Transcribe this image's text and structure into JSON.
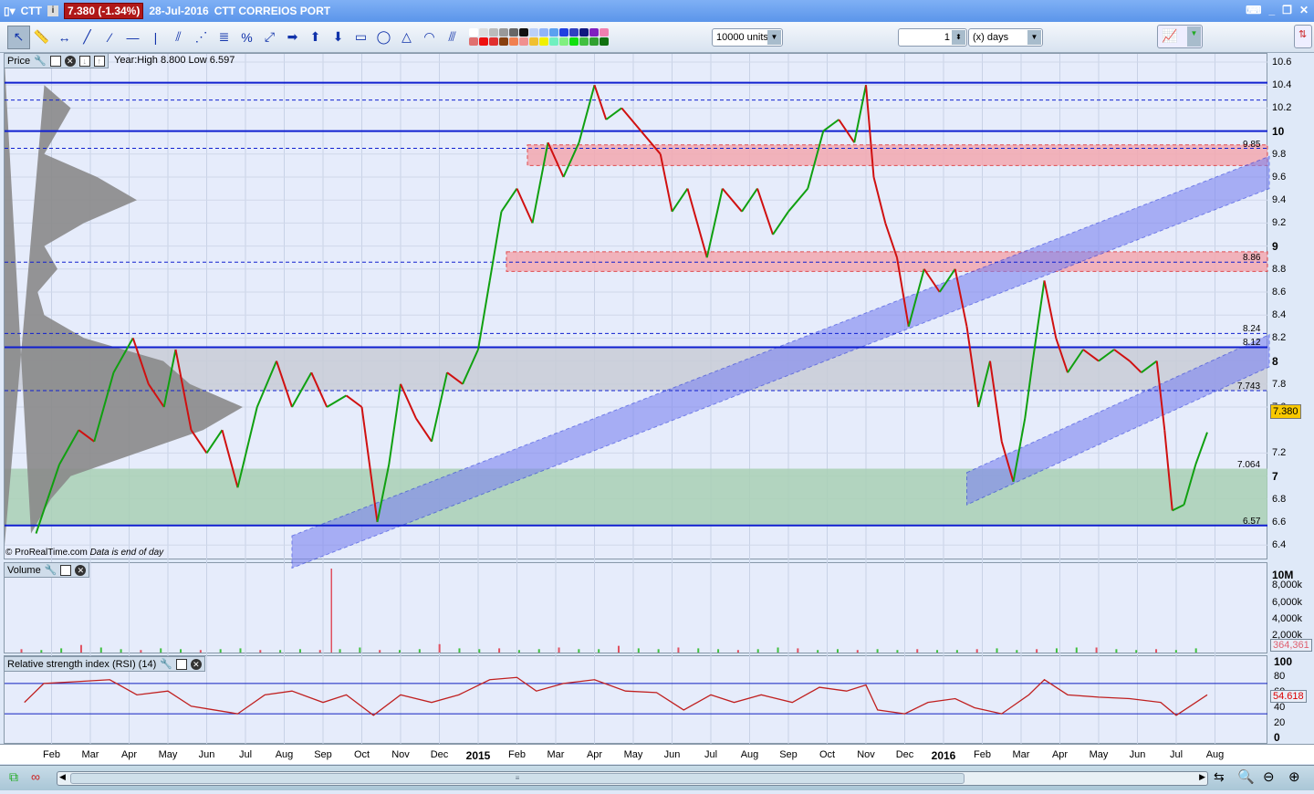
{
  "title": {
    "symbol": "CTT",
    "price_change": "7.380 (-1.34%)",
    "date": "28-Jul-2016",
    "name": "CTT CORREIOS PORT"
  },
  "toolbar": {
    "tools": [
      {
        "name": "pointer",
        "glyph": "↖"
      },
      {
        "name": "ruler",
        "glyph": "📏"
      },
      {
        "name": "horizontal-measure",
        "glyph": "↔"
      },
      {
        "name": "trendline",
        "glyph": "╱"
      },
      {
        "name": "segment",
        "glyph": "⁄"
      },
      {
        "name": "horizontal-line",
        "glyph": "—"
      },
      {
        "name": "vertical-line",
        "glyph": "|"
      },
      {
        "name": "channel",
        "glyph": "⫽"
      },
      {
        "name": "fan",
        "glyph": "⋰"
      },
      {
        "name": "fibonacci",
        "glyph": "≣"
      },
      {
        "name": "percent",
        "glyph": "%"
      },
      {
        "name": "point",
        "glyph": "⤢"
      },
      {
        "name": "arrow-right",
        "glyph": "➡"
      },
      {
        "name": "arrow-up",
        "glyph": "⬆"
      },
      {
        "name": "arrow-down",
        "glyph": "⬇"
      },
      {
        "name": "rectangle",
        "glyph": "▭"
      },
      {
        "name": "ellipse",
        "glyph": "◯"
      },
      {
        "name": "triangle",
        "glyph": "△"
      },
      {
        "name": "arcs",
        "glyph": "◠"
      },
      {
        "name": "gann",
        "glyph": "⫻"
      }
    ],
    "units": "10000 units",
    "period_value": "1",
    "period_unit": "(x) days",
    "colors": [
      "#ffffff",
      "#dddddd",
      "#bbbbbb",
      "#999999",
      "#666666",
      "#111111",
      "#bcd0f8",
      "#90b4f8",
      "#5aa0f0",
      "#2040e0",
      "#3040c0",
      "#101880",
      "#8020c0",
      "#f080b0",
      "#e07070",
      "#ee1010",
      "#e03030",
      "#884010",
      "#f08050",
      "#f09090",
      "#f0c030",
      "#f0f000",
      "#70f0c0",
      "#80f080",
      "#10e010",
      "#40c040",
      "#30a030",
      "#107010"
    ]
  },
  "price_panel": {
    "label": "Price",
    "info": "Year:High 8.800 Low 6.597",
    "copyright": "© ProRealTime.com",
    "note": "Data is end of day"
  },
  "volume_panel": {
    "label": "Volume",
    "last_value": "364,361",
    "ticks": [
      "10M",
      "8,000k",
      "6,000k",
      "4,000k",
      "2,000k"
    ]
  },
  "rsi_panel": {
    "label": "Relative strength index (RSI) (14)",
    "last_value": "54.618",
    "ticks": [
      "100",
      "80",
      "60",
      "40",
      "20",
      "0"
    ]
  },
  "current_price": "7.380",
  "level_labels": [
    "9.85",
    "8.86",
    "8.24",
    "8.12",
    "7.743",
    "7.064",
    "6.57"
  ],
  "chart_data": {
    "type": "line",
    "title": "CTT CORREIOS PORT daily",
    "x_unit": "months since Jan 2014",
    "ylim": [
      6.3,
      10.7
    ],
    "yticks": [
      "10.6",
      "10.4",
      "10.2",
      "10",
      "9.8",
      "9.6",
      "9.4",
      "9.2",
      "9",
      "8.8",
      "8.6",
      "8.4",
      "8.2",
      "8",
      "7.8",
      "7.6",
      "7.2",
      "7",
      "6.8",
      "6.6",
      "6.4"
    ],
    "ytick_values": [
      10.6,
      10.4,
      10.2,
      10,
      9.8,
      9.6,
      9.4,
      9.2,
      9,
      8.8,
      8.6,
      8.4,
      8.2,
      8,
      7.8,
      7.6,
      7.2,
      7,
      6.8,
      6.6,
      6.4
    ],
    "xticks": [
      {
        "label": "Feb",
        "m": 1
      },
      {
        "label": "Mar",
        "m": 2
      },
      {
        "label": "Apr",
        "m": 3
      },
      {
        "label": "May",
        "m": 4
      },
      {
        "label": "Jun",
        "m": 5
      },
      {
        "label": "Jul",
        "m": 6
      },
      {
        "label": "Aug",
        "m": 7
      },
      {
        "label": "Sep",
        "m": 8
      },
      {
        "label": "Oct",
        "m": 9
      },
      {
        "label": "Nov",
        "m": 10
      },
      {
        "label": "Dec",
        "m": 11
      },
      {
        "label": "2015",
        "m": 12
      },
      {
        "label": "Feb",
        "m": 13
      },
      {
        "label": "Mar",
        "m": 14
      },
      {
        "label": "Apr",
        "m": 15
      },
      {
        "label": "May",
        "m": 16
      },
      {
        "label": "Jun",
        "m": 17
      },
      {
        "label": "Jul",
        "m": 18
      },
      {
        "label": "Aug",
        "m": 19
      },
      {
        "label": "Sep",
        "m": 20
      },
      {
        "label": "Oct",
        "m": 21
      },
      {
        "label": "Nov",
        "m": 22
      },
      {
        "label": "Dec",
        "m": 23
      },
      {
        "label": "2016",
        "m": 24
      },
      {
        "label": "Feb",
        "m": 25
      },
      {
        "label": "Mar",
        "m": 26
      },
      {
        "label": "Apr",
        "m": 27
      },
      {
        "label": "May",
        "m": 28
      },
      {
        "label": "Jun",
        "m": 29
      },
      {
        "label": "Jul",
        "m": 30
      },
      {
        "label": "Aug",
        "m": 31
      }
    ],
    "price": [
      [
        0.6,
        6.5
      ],
      [
        0.9,
        6.8
      ],
      [
        1.2,
        7.1
      ],
      [
        1.7,
        7.4
      ],
      [
        2.1,
        7.3
      ],
      [
        2.6,
        7.9
      ],
      [
        3.1,
        8.2
      ],
      [
        3.5,
        7.8
      ],
      [
        3.9,
        7.6
      ],
      [
        4.2,
        8.1
      ],
      [
        4.6,
        7.4
      ],
      [
        5.0,
        7.2
      ],
      [
        5.4,
        7.4
      ],
      [
        5.8,
        6.9
      ],
      [
        6.3,
        7.6
      ],
      [
        6.8,
        8.0
      ],
      [
        7.2,
        7.6
      ],
      [
        7.7,
        7.9
      ],
      [
        8.1,
        7.6
      ],
      [
        8.6,
        7.7
      ],
      [
        9.0,
        7.6
      ],
      [
        9.4,
        6.6
      ],
      [
        9.7,
        7.1
      ],
      [
        10.0,
        7.8
      ],
      [
        10.4,
        7.5
      ],
      [
        10.8,
        7.3
      ],
      [
        11.2,
        7.9
      ],
      [
        11.6,
        7.8
      ],
      [
        12.0,
        8.1
      ],
      [
        12.3,
        8.7
      ],
      [
        12.6,
        9.3
      ],
      [
        13.0,
        9.5
      ],
      [
        13.4,
        9.2
      ],
      [
        13.8,
        9.9
      ],
      [
        14.2,
        9.6
      ],
      [
        14.6,
        9.9
      ],
      [
        15.0,
        10.4
      ],
      [
        15.3,
        10.1
      ],
      [
        15.7,
        10.2
      ],
      [
        16.2,
        10.0
      ],
      [
        16.7,
        9.8
      ],
      [
        17.0,
        9.3
      ],
      [
        17.4,
        9.5
      ],
      [
        17.9,
        8.9
      ],
      [
        18.3,
        9.5
      ],
      [
        18.8,
        9.3
      ],
      [
        19.2,
        9.5
      ],
      [
        19.6,
        9.1
      ],
      [
        20.0,
        9.3
      ],
      [
        20.5,
        9.5
      ],
      [
        20.9,
        10.0
      ],
      [
        21.3,
        10.1
      ],
      [
        21.7,
        9.9
      ],
      [
        22.0,
        10.4
      ],
      [
        22.2,
        9.6
      ],
      [
        22.5,
        9.2
      ],
      [
        22.8,
        8.9
      ],
      [
        23.1,
        8.3
      ],
      [
        23.5,
        8.8
      ],
      [
        23.9,
        8.6
      ],
      [
        24.3,
        8.8
      ],
      [
        24.6,
        8.3
      ],
      [
        24.9,
        7.6
      ],
      [
        25.2,
        8.0
      ],
      [
        25.5,
        7.3
      ],
      [
        25.8,
        6.95
      ],
      [
        26.1,
        7.5
      ],
      [
        26.3,
        8.0
      ],
      [
        26.6,
        8.7
      ],
      [
        26.9,
        8.2
      ],
      [
        27.2,
        7.9
      ],
      [
        27.6,
        8.1
      ],
      [
        28.0,
        8.0
      ],
      [
        28.4,
        8.1
      ],
      [
        28.8,
        8.0
      ],
      [
        29.1,
        7.9
      ],
      [
        29.5,
        8.0
      ],
      [
        29.7,
        7.4
      ],
      [
        29.9,
        6.7
      ],
      [
        30.2,
        6.75
      ],
      [
        30.5,
        7.1
      ],
      [
        30.8,
        7.38
      ]
    ],
    "levels": [
      {
        "price": 10.42,
        "style": "solid"
      },
      {
        "price": 10.27,
        "style": "dashed"
      },
      {
        "price": 10.0,
        "style": "solid"
      },
      {
        "price": 9.85,
        "style": "dashed"
      },
      {
        "price": 8.86,
        "style": "dashed"
      },
      {
        "price": 8.24,
        "style": "dashed"
      },
      {
        "price": 8.12,
        "style": "solid"
      },
      {
        "price": 7.743,
        "style": "dashed"
      },
      {
        "price": 6.57,
        "style": "solid"
      }
    ],
    "zones": [
      {
        "from": 9.7,
        "to": 9.88,
        "color": "#f4a8b0"
      },
      {
        "from": 8.78,
        "to": 8.95,
        "color": "#f4a8b0"
      },
      {
        "from": 7.743,
        "to": 8.12,
        "color": "#c8ccd6"
      },
      {
        "from": 6.57,
        "to": 7.064,
        "color": "#a8d0b4"
      }
    ],
    "channels": [
      {
        "m1": 7.2,
        "p1": 6.2,
        "m2": 32.4,
        "p2": 9.5,
        "width": 0.28
      },
      {
        "m1": 24.6,
        "p1": 6.75,
        "m2": 32.4,
        "p2": 7.95,
        "width": 0.28
      }
    ],
    "volume_profile": [
      [
        6.5,
        0.2
      ],
      [
        6.8,
        0.35
      ],
      [
        7.0,
        0.5
      ],
      [
        7.2,
        1.0
      ],
      [
        7.4,
        1.5
      ],
      [
        7.6,
        1.8
      ],
      [
        7.8,
        1.4
      ],
      [
        8.0,
        1.2
      ],
      [
        8.2,
        0.6
      ],
      [
        8.4,
        0.3
      ],
      [
        8.6,
        0.25
      ],
      [
        8.8,
        0.4
      ],
      [
        9.0,
        0.3
      ],
      [
        9.2,
        0.6
      ],
      [
        9.4,
        1.0
      ],
      [
        9.6,
        0.7
      ],
      [
        9.8,
        0.3
      ],
      [
        10.0,
        0.4
      ],
      [
        10.2,
        0.5
      ],
      [
        10.4,
        0.3
      ]
    ],
    "volume": [
      0.4,
      0.3,
      0.5,
      0.9,
      0.6,
      0.4,
      0.3,
      0.5,
      0.4,
      0.3,
      0.4,
      0.5,
      0.3,
      0.3,
      0.4,
      0.3,
      0.4,
      0.6,
      0.3,
      0.3,
      0.4,
      1.0,
      0.5,
      0.4,
      0.5,
      0.3,
      0.4,
      0.6,
      0.4,
      0.4,
      0.8,
      0.5,
      0.4,
      0.6,
      0.5,
      0.4,
      0.3,
      0.4,
      0.6,
      0.5,
      0.3,
      0.4,
      0.3,
      0.4,
      0.3,
      0.4,
      0.3,
      0.3,
      0.4,
      0.5,
      0.3,
      0.4,
      0.5,
      0.6,
      0.6,
      0.4,
      0.3,
      0.4,
      0.3,
      0.5
    ],
    "volume_spike": {
      "m": 8.2,
      "value": 10.0
    },
    "rsi": [
      [
        0.3,
        45
      ],
      [
        0.8,
        70
      ],
      [
        1.5,
        72
      ],
      [
        2.5,
        75
      ],
      [
        3.2,
        55
      ],
      [
        4.0,
        60
      ],
      [
        4.6,
        40
      ],
      [
        5.2,
        35
      ],
      [
        5.8,
        30
      ],
      [
        6.5,
        55
      ],
      [
        7.2,
        60
      ],
      [
        8.0,
        45
      ],
      [
        8.6,
        55
      ],
      [
        9.3,
        28
      ],
      [
        10.0,
        55
      ],
      [
        10.8,
        45
      ],
      [
        11.5,
        55
      ],
      [
        12.3,
        75
      ],
      [
        13.0,
        78
      ],
      [
        13.5,
        60
      ],
      [
        14.2,
        70
      ],
      [
        15.0,
        75
      ],
      [
        15.8,
        60
      ],
      [
        16.6,
        58
      ],
      [
        17.3,
        35
      ],
      [
        18.0,
        55
      ],
      [
        18.6,
        45
      ],
      [
        19.3,
        55
      ],
      [
        20.1,
        45
      ],
      [
        20.8,
        65
      ],
      [
        21.5,
        60
      ],
      [
        22.0,
        68
      ],
      [
        22.3,
        35
      ],
      [
        23.0,
        30
      ],
      [
        23.6,
        45
      ],
      [
        24.3,
        50
      ],
      [
        24.8,
        38
      ],
      [
        25.5,
        30
      ],
      [
        26.2,
        55
      ],
      [
        26.6,
        75
      ],
      [
        27.2,
        55
      ],
      [
        28.0,
        52
      ],
      [
        28.8,
        50
      ],
      [
        29.6,
        45
      ],
      [
        30.0,
        28
      ],
      [
        30.3,
        38
      ],
      [
        30.8,
        55
      ]
    ]
  }
}
